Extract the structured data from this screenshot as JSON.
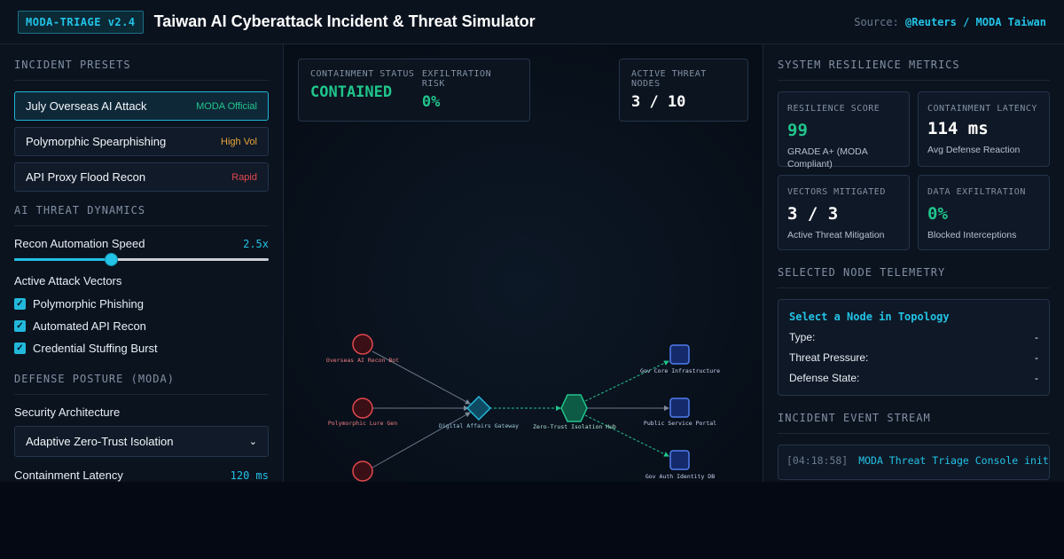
{
  "header": {
    "badge": "MODA-TRIAGE v2.4",
    "title": "Taiwan AI Cyberattack Incident & Threat Simulator",
    "source_label": "Source:",
    "source_value": "@Reuters / MODA Taiwan"
  },
  "presets": {
    "title": "INCIDENT PRESETS",
    "items": [
      {
        "label": "July Overseas AI Attack",
        "tag": "MODA Official",
        "tag_color": "#20c58c"
      },
      {
        "label": "Polymorphic Spearphishing",
        "tag": "High Vol",
        "tag_color": "#e8a33a"
      },
      {
        "label": "API Proxy Flood Recon",
        "tag": "Rapid",
        "tag_color": "#e5484d"
      }
    ]
  },
  "dynamics": {
    "title": "AI THREAT DYNAMICS",
    "speed_label": "Recon Automation Speed",
    "speed_value": "2.5x",
    "speed_fraction": 0.38,
    "vectors_label": "Active Attack Vectors",
    "vectors": [
      {
        "label": "Polymorphic Phishing",
        "checked": true
      },
      {
        "label": "Automated API Recon",
        "checked": true
      },
      {
        "label": "Credential Stuffing Burst",
        "checked": true
      }
    ]
  },
  "defense": {
    "title": "DEFENSE POSTURE (MODA)",
    "arch_label": "Security Architecture",
    "arch_value": "Adaptive Zero-Trust Isolation",
    "latency_label": "Containment Latency",
    "latency_value": "120 ms"
  },
  "status": {
    "containment_label": "CONTAINMENT STATUS",
    "containment_value": "CONTAINED",
    "exfil_label": "EXFILTRATION RISK",
    "exfil_value": "0%",
    "nodes_label": "ACTIVE THREAT NODES",
    "nodes_value": "3 / 10"
  },
  "topology": {
    "nodes": [
      {
        "id": "recon",
        "label": "Overseas AI Recon Bot",
        "kind": "threat"
      },
      {
        "id": "lure",
        "label": "Polymorphic Lure Gen",
        "kind": "threat"
      },
      {
        "id": "burst",
        "label": "",
        "kind": "threat"
      },
      {
        "id": "gateway",
        "label": "Digital Affairs Gateway",
        "kind": "gateway"
      },
      {
        "id": "hub",
        "label": "Zero-Trust Isolation Hub",
        "kind": "hub"
      },
      {
        "id": "infra",
        "label": "Gov Core Infrastructure",
        "kind": "asset"
      },
      {
        "id": "portal",
        "label": "Public Service Portal",
        "kind": "asset"
      },
      {
        "id": "authdb",
        "label": "Gov Auth Identity DB",
        "kind": "asset"
      }
    ]
  },
  "metrics": {
    "title": "SYSTEM RESILIENCE METRICS",
    "items": [
      {
        "label": "RESILIENCE SCORE",
        "value": "99",
        "sub": "GRADE A+ (MODA Compliant)",
        "color": "#20c58c"
      },
      {
        "label": "CONTAINMENT LATENCY",
        "value": "114 ms",
        "sub": "Avg Defense Reaction",
        "color": "#ffffff"
      },
      {
        "label": "VECTORS MITIGATED",
        "value": "3 / 3",
        "sub": "Active Threat Mitigation",
        "color": "#ffffff"
      },
      {
        "label": "DATA EXFILTRATION",
        "value": "0%",
        "sub": "Blocked Interceptions",
        "color": "#20c58c"
      }
    ]
  },
  "telemetry": {
    "title": "SELECTED NODE TELEMETRY",
    "prompt": "Select a Node in Topology",
    "rows": [
      {
        "label": "Type:",
        "value": "-"
      },
      {
        "label": "Threat Pressure:",
        "value": "-"
      },
      {
        "label": "Defense State:",
        "value": "-"
      }
    ]
  },
  "stream": {
    "title": "INCIDENT EVENT STREAM",
    "time": "[04:18:58]",
    "message": "MODA Threat Triage Console initialized"
  }
}
